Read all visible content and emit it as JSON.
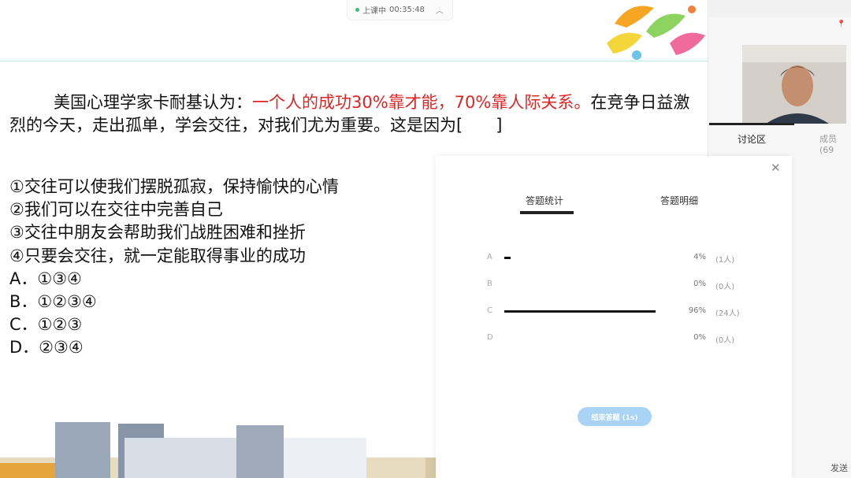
{
  "status": {
    "label": "上课中",
    "timer": "00:35:48"
  },
  "question": {
    "intro": "美国心理学家卡耐基认为：",
    "highlight": "一个人的成功30%靠才能，70%靠人际关系。",
    "rest": "在竞争日益激烈的今天，走出孤单，学会交往，对我们尤为重要。这是因为[　　]"
  },
  "statements": [
    "①交往可以使我们摆脱孤寂，保持愉快的心情",
    "②我们可以在交往中完善自己",
    "③交往中朋友会帮助我们战胜困难和挫折",
    "④只要会交往，就一定能取得事业的成功"
  ],
  "choices": [
    "A．①③④",
    "B．①②③④",
    "C．①②③",
    "D．②③④"
  ],
  "popup": {
    "tab_stats": "答题统计",
    "tab_detail": "答题明细",
    "results": [
      {
        "letter": "A",
        "pct": "4%",
        "count": "(1人)",
        "fraction": 0.04
      },
      {
        "letter": "B",
        "pct": "0%",
        "count": "(0人)",
        "fraction": 0.0
      },
      {
        "letter": "C",
        "pct": "96%",
        "count": "(24人)",
        "fraction": 0.96
      },
      {
        "letter": "D",
        "pct": "0%",
        "count": "(0人)",
        "fraction": 0.0
      }
    ],
    "end_button": "结束答题 (1s)"
  },
  "side": {
    "tab_discussion": "讨论区",
    "tab_members": "成员(69",
    "send": "发送"
  },
  "colors": {
    "highlight": "#e02424",
    "button": "#a9d4f5",
    "live": "#34c17b"
  }
}
